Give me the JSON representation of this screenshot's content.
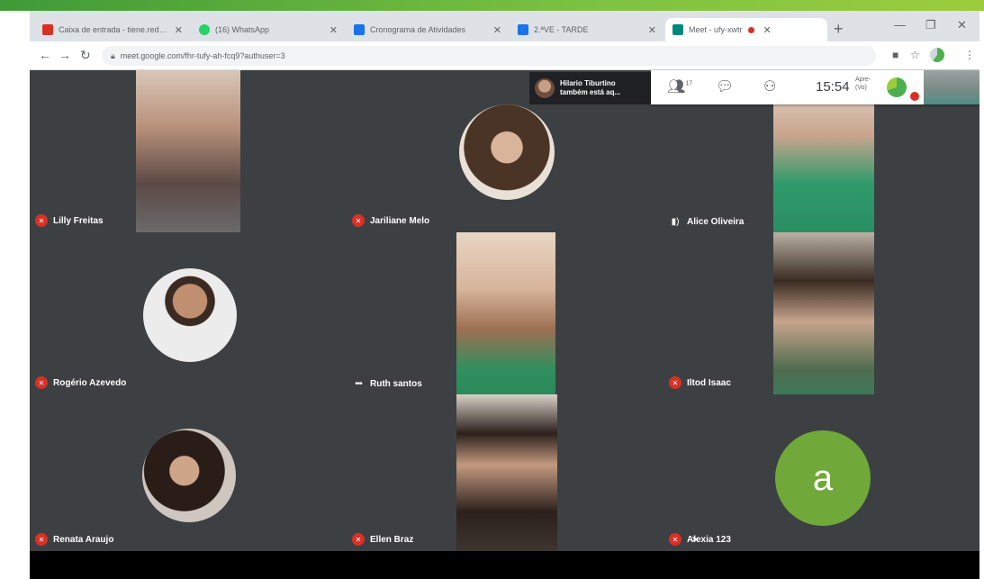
{
  "browser": {
    "tabs": [
      {
        "title": "Caixa de entrada - tiene.redes - x",
        "icon": "gmail-icon",
        "color": "#d93025"
      },
      {
        "title": "(16) WhatsApp",
        "icon": "whatsapp-icon",
        "color": "#25d366"
      },
      {
        "title": "Cronograma de Atividades",
        "icon": "docs-icon",
        "color": "#1a73e8"
      },
      {
        "title": "2.ªVE - TARDE",
        "icon": "docs-icon",
        "color": "#1a73e8"
      },
      {
        "title": "Meet - ufy-xwtr",
        "icon": "meet-icon",
        "color": "#00897b",
        "active": true
      }
    ],
    "url": "meet.google.com/fhr-tufy-ah-fcq9?authuser=3"
  },
  "notification": {
    "line1": "Hilario Tiburtino",
    "line2": "também está aq..."
  },
  "meet_bar": {
    "participant_count": "17",
    "clock": "15:54",
    "label_line1": "Apre-",
    "label_line2": "(Vo)"
  },
  "participants": [
    {
      "name": "Lilly Freitas",
      "mic": "off"
    },
    {
      "name": "Jariliane Melo",
      "mic": "off"
    },
    {
      "name": "Alice Oliveira",
      "mic": "on"
    },
    {
      "name": "Rogério Azevedo",
      "mic": "off"
    },
    {
      "name": "Ruth santos",
      "mic": "more"
    },
    {
      "name": "Iltod Isaac",
      "mic": "off"
    },
    {
      "name": "Renata Araujo",
      "mic": "off"
    },
    {
      "name": "Ellen Braz",
      "mic": "off"
    },
    {
      "name": "Alexia 123",
      "mic": "off",
      "avatar_letter": "a",
      "avatar_color": "#70a839"
    }
  ]
}
